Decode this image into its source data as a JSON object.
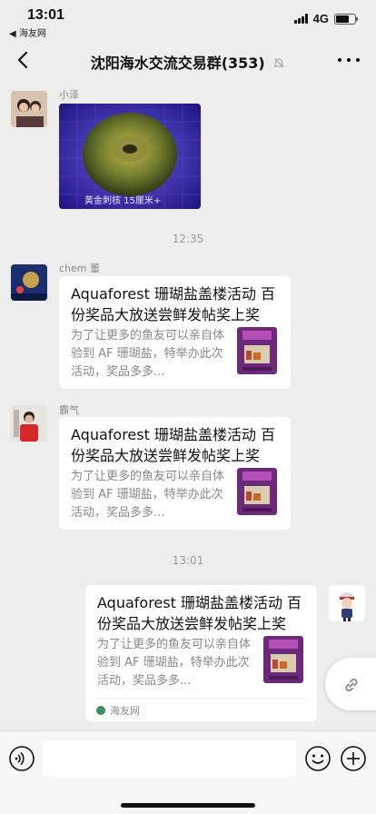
{
  "status_bar": {
    "time": "13:01",
    "back_app": "◀ 海友网",
    "network": "4G"
  },
  "nav": {
    "title": "沈阳海水交流交易群(353)"
  },
  "messages": [
    {
      "type": "image",
      "sender": "小泽",
      "caption": "黄金刺核 15厘米+"
    },
    {
      "type": "time",
      "text": "12:35"
    },
    {
      "type": "link_card",
      "sender": "chem 董",
      "title": "Aquaforest 珊瑚盐盖楼活动 百份奖品大放送尝鲜发帖奖上奖",
      "desc": "为了让更多的鱼友可以亲自体验到 AF 珊瑚盐，特举办此次活动，奖品多多..."
    },
    {
      "type": "link_card",
      "sender": "霸气",
      "title": "Aquaforest 珊瑚盐盖楼活动 百份奖品大放送尝鲜发帖奖上奖",
      "desc": "为了让更多的鱼友可以亲自体验到 AF 珊瑚盐，特举办此次活动，奖品多多..."
    },
    {
      "type": "time",
      "text": "13:01"
    },
    {
      "type": "link_card_self",
      "title": "Aquaforest 珊瑚盐盖楼活动 百份奖品大放送尝鲜发帖奖上奖",
      "desc": "为了让更多的鱼友可以亲自体验到 AF 珊瑚盐，特举办此次活动，奖品多多...",
      "source": "海友网"
    }
  ],
  "icons": {
    "back": "chevron-left-icon",
    "more": "more-dots-icon",
    "mute": "bell-off-icon",
    "voice": "voice-icon",
    "emoji": "emoji-icon",
    "add": "plus-icon",
    "link": "link-icon"
  },
  "colors": {
    "background": "#ededed",
    "bubble": "#ffffff",
    "muted_text": "#888888"
  }
}
